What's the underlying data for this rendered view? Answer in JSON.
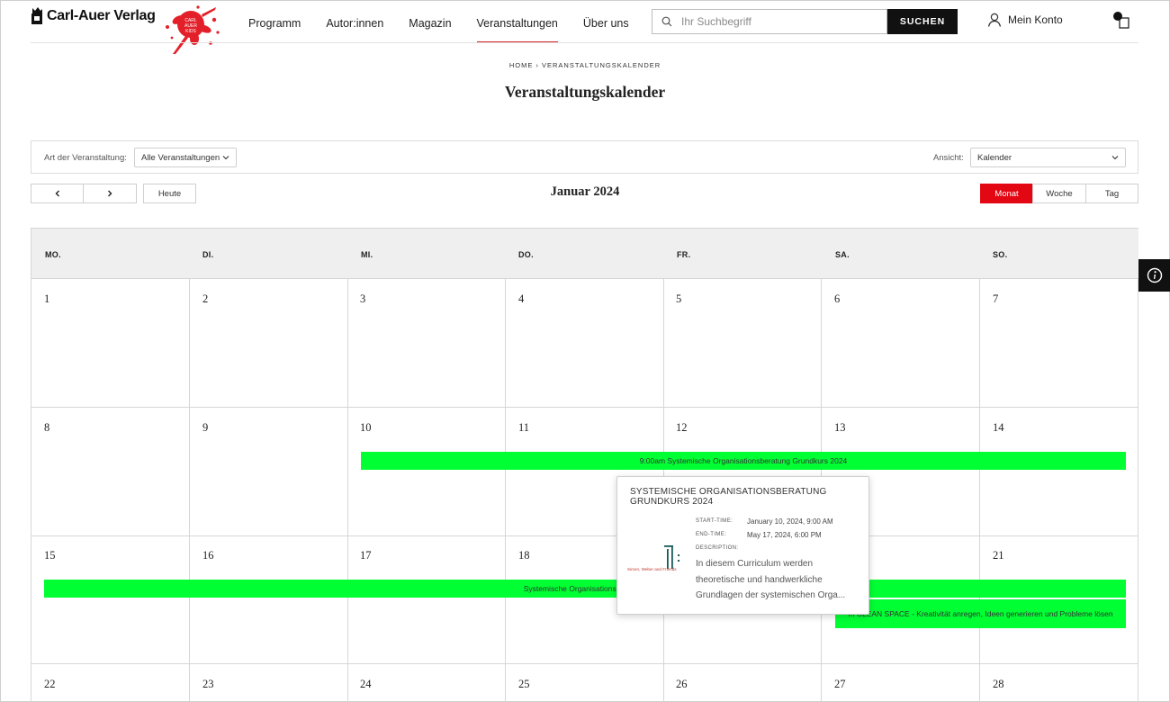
{
  "header": {
    "logo_text": "Carl-Auer Verlag",
    "splash_text": "CARL AUER KIDS",
    "nav": [
      "Programm",
      "Autor:innen",
      "Magazin",
      "Veranstaltungen",
      "Über uns"
    ],
    "active_nav": "Veranstaltungen",
    "search_placeholder": "Ihr Suchbegriff",
    "search_button": "SUCHEN",
    "account_label": "Mein Konto"
  },
  "breadcrumb": "HOME › VERANSTALTUNGSKALENDER",
  "page_title": "Veranstaltungskalender",
  "filters": {
    "type_label": "Art der Veranstaltung:",
    "type_value": "Alle Veranstaltungen",
    "view_label": "Ansicht:",
    "view_value": "Kalender"
  },
  "toolbar": {
    "prev": "<",
    "next": ">",
    "today": "Heute",
    "month_title": "Januar 2024",
    "views": [
      "Monat",
      "Woche",
      "Tag"
    ],
    "active_view": "Monat"
  },
  "weekdays": [
    "MO.",
    "DI.",
    "MI.",
    "DO.",
    "FR.",
    "SA.",
    "SO."
  ],
  "weeks": [
    [
      "1",
      "2",
      "3",
      "4",
      "5",
      "6",
      "7"
    ],
    [
      "8",
      "9",
      "10",
      "11",
      "12",
      "13",
      "14"
    ],
    [
      "15",
      "16",
      "17",
      "18",
      "19",
      "20",
      "21"
    ],
    [
      "22",
      "23",
      "24",
      "25",
      "26",
      "27",
      "28"
    ]
  ],
  "events": {
    "week2_bar": "9:00am  Systemische Organisationsberatung Grundkurs 2024",
    "week3_bar": "Systemische Organisationsberatung",
    "week3_clean_space": "m  CLEAN SPACE - Kreativität anregen, Ideen generieren und Probleme lösen",
    "color": "#00ff33"
  },
  "popup": {
    "title": "SYSTEMISCHE ORGANISATIONSBERATUNG GRUNDKURS 2024",
    "start_label": "START-TIME:",
    "start_value": "January 10, 2024, 9:00 AM",
    "end_label": "END-TIME:",
    "end_value": "May 17, 2024, 6:00 PM",
    "desc_label": "DESCRIPTION:",
    "desc_lines": [
      "In diesem Curriculum werden",
      "theoretische und handwerkliche",
      "Grundlagen der systemischen Orga..."
    ],
    "logo_text": "Simon, Weber and Friends"
  },
  "colors": {
    "accent": "#e30613",
    "event_green": "#00ff33",
    "header_bg": "#efefef"
  }
}
